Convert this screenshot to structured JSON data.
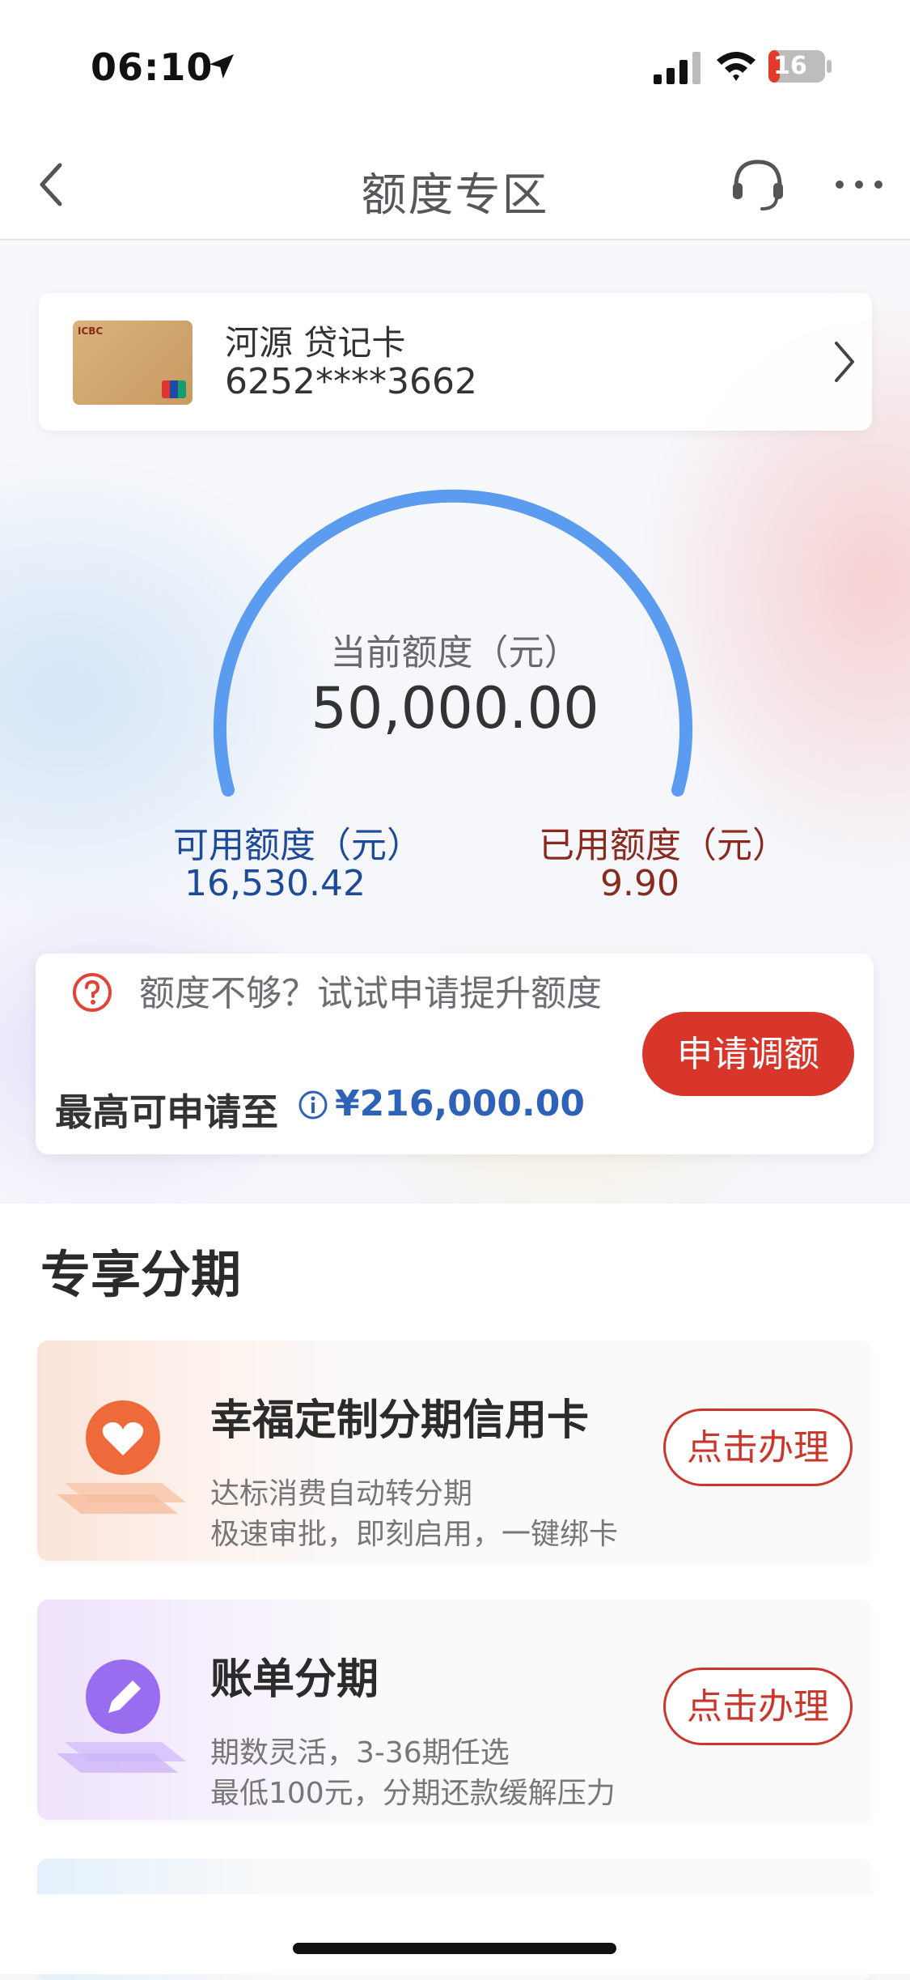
{
  "status_bar": {
    "time": "06:10",
    "battery": "16"
  },
  "nav": {
    "title": "额度专区"
  },
  "card": {
    "name": "河源 贷记卡",
    "number": "6252****3662"
  },
  "limit": {
    "current_label": "当前额度（元）",
    "current_value": "50,000.00",
    "available_label": "可用额度（元）",
    "available_value": "16,530.42",
    "used_label": "已用额度（元）",
    "used_value": "9.90",
    "used_fraction": 0.0002
  },
  "raise": {
    "prompt": "额度不够？试试申请提升额度",
    "max_label": "最高可申请至",
    "max_value": "¥216,000.00",
    "apply_label": "申请调额"
  },
  "section": {
    "title": "专享分期",
    "items": [
      {
        "title": "幸福定制分期信用卡",
        "line1": "达标消费自动转分期",
        "line2": "极速审批，即刻启用，一键绑卡",
        "button": "点击办理"
      },
      {
        "title": "账单分期",
        "line1": "期数灵活，3-36期任选",
        "line2": "最低100元，分期还款缓解压力",
        "button": "点击办理"
      }
    ]
  },
  "colors": {
    "accent_red": "#d8362b",
    "gauge_blue": "#5b9bf0",
    "link_blue": "#2e62b8"
  },
  "icons": [
    "location-arrow-icon",
    "signal-icon",
    "wifi-icon",
    "battery-icon",
    "back-icon",
    "headset-icon",
    "more-icon",
    "chevron-right-icon",
    "question-icon",
    "info-icon",
    "heart-icon",
    "pencil-icon"
  ]
}
